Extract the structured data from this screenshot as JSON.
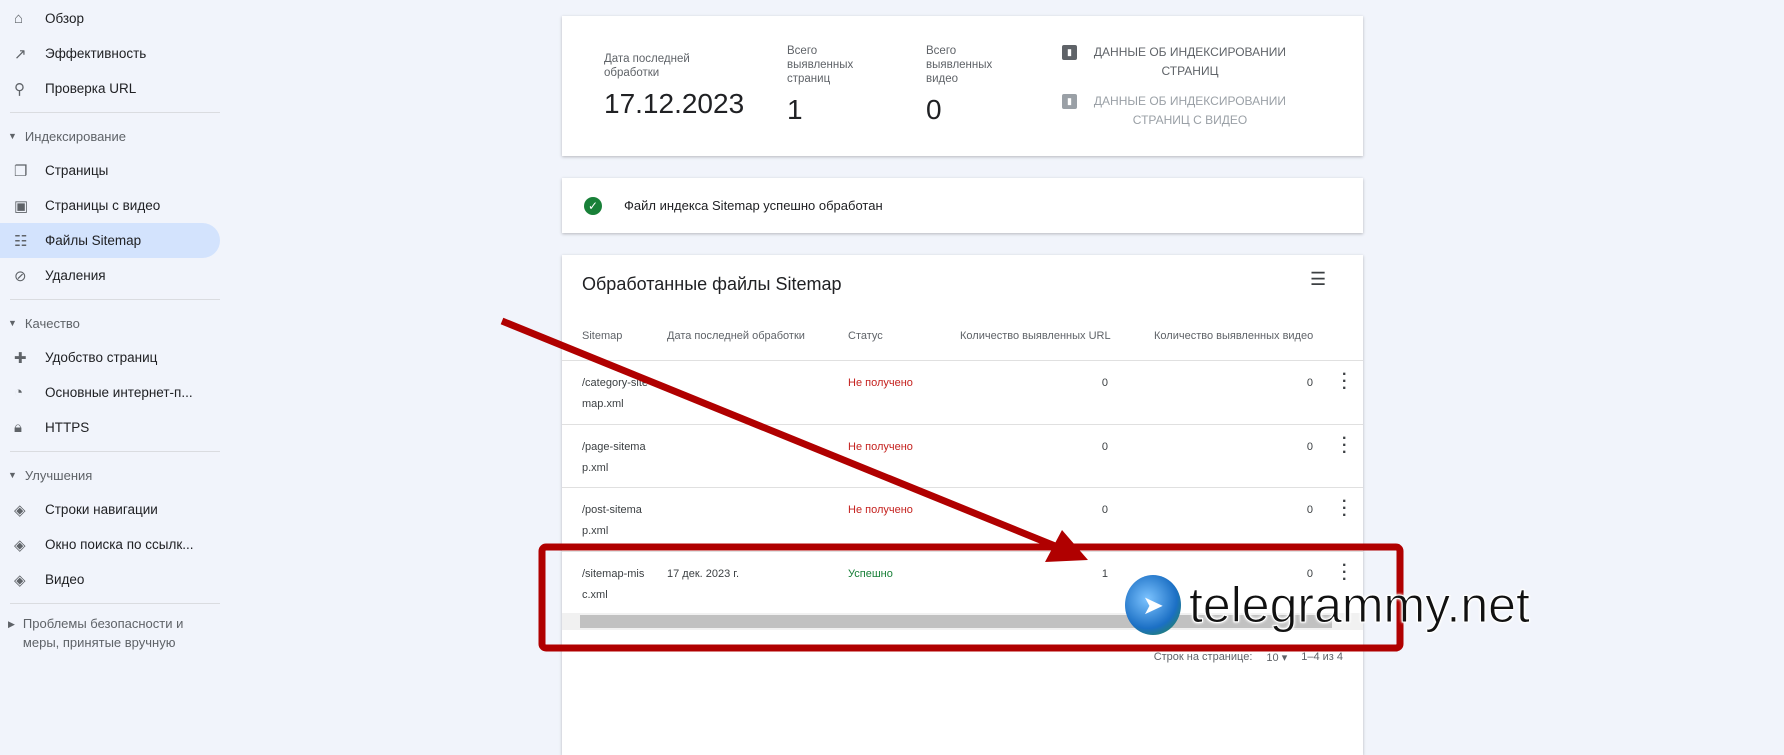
{
  "sidebar": {
    "top": [
      {
        "label": "Обзор",
        "icon": "home-icon"
      },
      {
        "label": "Эффективность",
        "icon": "trending-icon"
      },
      {
        "label": "Проверка URL",
        "icon": "search-icon"
      }
    ],
    "sections": [
      {
        "title": "Индексирование",
        "items": [
          {
            "label": "Страницы"
          },
          {
            "label": "Страницы с видео"
          },
          {
            "label": "Файлы Sitemap",
            "active": true
          },
          {
            "label": "Удаления"
          }
        ]
      },
      {
        "title": "Качество",
        "items": [
          {
            "label": "Удобство страниц"
          },
          {
            "label": "Основные интернет-п..."
          },
          {
            "label": "HTTPS"
          }
        ]
      },
      {
        "title": "Улучшения",
        "items": [
          {
            "label": "Строки навигации"
          },
          {
            "label": "Окно поиска по ссылк..."
          },
          {
            "label": "Видео"
          }
        ]
      },
      {
        "title": "Проблемы безопасности и меры, принятые вручную"
      }
    ]
  },
  "summary": {
    "last_processed_label": "Дата последней обработки",
    "last_processed": "17.12.2023",
    "pages_label": "Всего выявленных страниц",
    "pages": "1",
    "videos_label": "Всего выявленных видео",
    "videos": "0",
    "link1": "ДАННЫЕ ОБ ИНДЕКСИРОВАНИИ СТРАНИЦ",
    "link2": "ДАННЫЕ ОБ ИНДЕКСИРОВАНИИ СТРАНИЦ С ВИДЕО"
  },
  "status_message": "Файл индекса Sitemap успешно обработан",
  "table": {
    "title": "Обработанные файлы Sitemap",
    "headers": [
      "Sitemap",
      "Дата последней обработки",
      "Статус",
      "Количество выявленных URL",
      "Количество выявленных видео"
    ],
    "rows": [
      {
        "sitemap": "/category-sitemap.xml",
        "date": "",
        "status": "Не получено",
        "urls": "0",
        "videos": "0"
      },
      {
        "sitemap": "/page-sitemap.xml",
        "date": "",
        "status": "Не получено",
        "urls": "0",
        "videos": "0"
      },
      {
        "sitemap": "/post-sitemap.xml",
        "date": "",
        "status": "Не получено",
        "urls": "0",
        "videos": "0"
      },
      {
        "sitemap": "/sitemap-misc.xml",
        "date": "17 дек. 2023 г.",
        "status": "Успешно",
        "urls": "1",
        "videos": "0"
      }
    ],
    "rows_per_page_label": "Строк на странице:",
    "rows_per_page": "10",
    "range": "1–4 из 4"
  },
  "watermark": "telegrammy.net",
  "colors": {
    "error": "#c5221f",
    "success": "#188038",
    "annotation": "#b00000"
  }
}
